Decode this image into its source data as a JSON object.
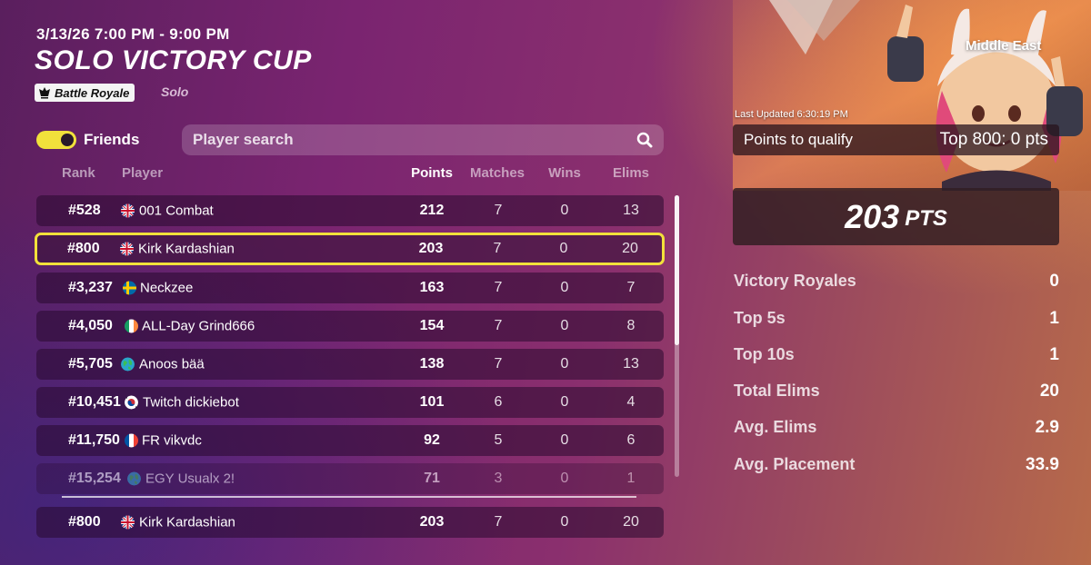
{
  "event": {
    "datetime": "3/13/26 7:00 PM - 9:00 PM",
    "title": "SOLO VICTORY CUP",
    "mode_badge": "Battle Royale",
    "mode_sub": "Solo"
  },
  "filters": {
    "friends_label": "Friends",
    "friends_on": true,
    "search_placeholder": "Player search"
  },
  "columns": {
    "rank": "Rank",
    "player": "Player",
    "points": "Points",
    "matches": "Matches",
    "wins": "Wins",
    "elims": "Elims"
  },
  "rows": [
    {
      "rank": "#528",
      "flag": "gb-flag-icon",
      "name": "001 Combat",
      "points": "212",
      "matches": "7",
      "wins": "0",
      "elims": "13"
    },
    {
      "rank": "#800",
      "flag": "gb-flag-icon",
      "name": "Kirk Kardashian",
      "points": "203",
      "matches": "7",
      "wins": "0",
      "elims": "20"
    },
    {
      "rank": "#3,237",
      "flag": "se-flag-icon",
      "name": "Neckzee",
      "points": "163",
      "matches": "7",
      "wins": "0",
      "elims": "7"
    },
    {
      "rank": "#4,050",
      "flag": "ie-flag-icon",
      "name": "ALL-Day Grind666",
      "points": "154",
      "matches": "7",
      "wins": "0",
      "elims": "8"
    },
    {
      "rank": "#5,705",
      "flag": "globe-icon",
      "name": "Anoos bää",
      "points": "138",
      "matches": "7",
      "wins": "0",
      "elims": "13"
    },
    {
      "rank": "#10,451",
      "flag": "kr-flag-icon",
      "name": "Twitch dickiebot",
      "points": "101",
      "matches": "6",
      "wins": "0",
      "elims": "4"
    },
    {
      "rank": "#11,750",
      "flag": "fr-flag-icon",
      "name": "FR vikvdc",
      "points": "92",
      "matches": "5",
      "wins": "0",
      "elims": "6"
    },
    {
      "rank": "#15,254",
      "flag": "globe-icon",
      "name": "EGY Usualx 2!",
      "points": "71",
      "matches": "3",
      "wins": "0",
      "elims": "1"
    }
  ],
  "pinned_row": {
    "rank": "#800",
    "flag": "gb-flag-icon",
    "name": "Kirk Kardashian",
    "points": "203",
    "matches": "7",
    "wins": "0",
    "elims": "20"
  },
  "panel": {
    "region": "Middle East",
    "last_updated": "Last Updated 6:30:19 PM",
    "qualify_label": "Points to qualify",
    "qualify_value": "Top 800: 0 pts",
    "points_big": "203",
    "points_unit": "PTS",
    "stats": [
      {
        "label": "Victory Royales",
        "value": "0"
      },
      {
        "label": "Top 5s",
        "value": "1"
      },
      {
        "label": "Top 10s",
        "value": "1"
      },
      {
        "label": "Total Elims",
        "value": "20"
      },
      {
        "label": "Avg. Elims",
        "value": "2.9"
      },
      {
        "label": "Avg. Placement",
        "value": "33.9"
      }
    ]
  },
  "colors": {
    "accent_yellow": "#f2e13a",
    "row_bg": "#3a1440"
  }
}
